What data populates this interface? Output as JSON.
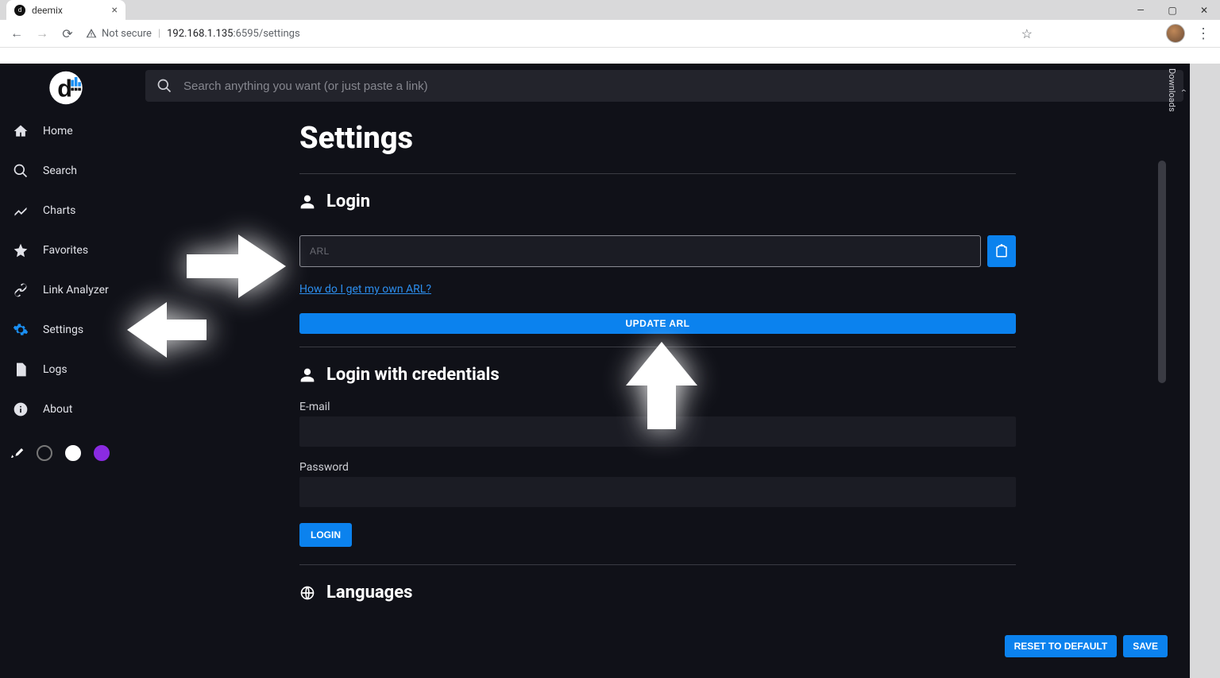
{
  "browser": {
    "tab_title": "deemix",
    "not_secure_label": "Not secure",
    "url_host": "192.168.1.135",
    "url_port_path": ":6595/settings"
  },
  "win_controls": {
    "min": "—",
    "max": "▢",
    "close": "✕"
  },
  "search": {
    "placeholder": "Search anything you want (or just paste a link)"
  },
  "sidebar": {
    "items": [
      {
        "label": "Home"
      },
      {
        "label": "Search"
      },
      {
        "label": "Charts"
      },
      {
        "label": "Favorites"
      },
      {
        "label": "Link Analyzer"
      },
      {
        "label": "Settings"
      },
      {
        "label": "Logs"
      },
      {
        "label": "About"
      }
    ]
  },
  "downloads": {
    "label": "Downloads"
  },
  "page": {
    "title": "Settings",
    "login": {
      "heading": "Login",
      "arl_placeholder": "ARL",
      "arl_help_link": "How do I get my own ARL?",
      "update_button": "UPDATE ARL"
    },
    "creds": {
      "heading": "Login with credentials",
      "email_label": "E-mail",
      "password_label": "Password",
      "login_button": "LOGIN"
    },
    "languages": {
      "heading": "Languages"
    },
    "footer": {
      "reset": "RESET TO DEFAULT",
      "save": "SAVE"
    }
  },
  "colors": {
    "accent": "#0b82ee"
  }
}
